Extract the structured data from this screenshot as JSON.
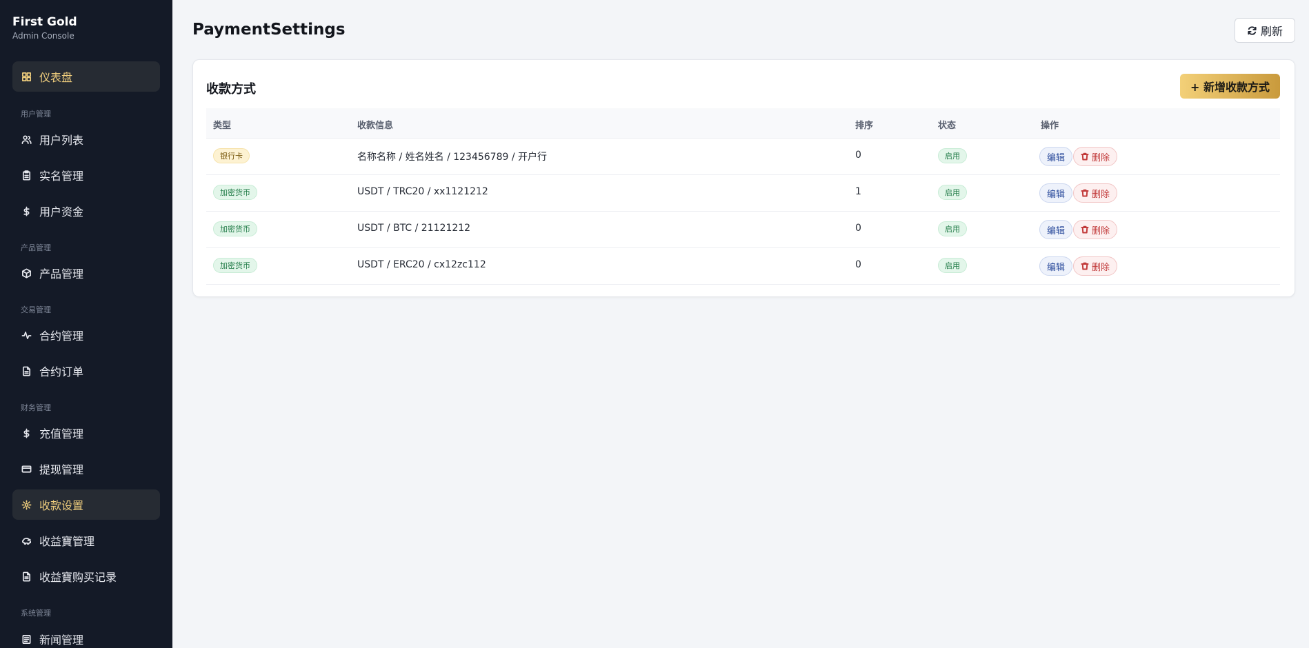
{
  "brand": {
    "title": "First Gold",
    "subtitle": "Admin Console"
  },
  "sidebar": {
    "groups": {
      "users": "用户管理",
      "products": "产品管理",
      "trading": "交易管理",
      "finance": "财务管理",
      "system": "系统管理"
    },
    "items": [
      {
        "label": "仪表盘",
        "icon": "dashboard-icon"
      },
      {
        "label": "用户列表",
        "icon": "users-icon"
      },
      {
        "label": "实名管理",
        "icon": "clipboard-icon"
      },
      {
        "label": "用户资金",
        "icon": "dollar-icon"
      },
      {
        "label": "产品管理",
        "icon": "box-icon"
      },
      {
        "label": "合约管理",
        "icon": "activity-icon"
      },
      {
        "label": "合约订单",
        "icon": "file-icon"
      },
      {
        "label": "充值管理",
        "icon": "dollar-icon"
      },
      {
        "label": "提现管理",
        "icon": "credit-card-icon"
      },
      {
        "label": "收款设置",
        "icon": "gear-icon"
      },
      {
        "label": "收益寶管理",
        "icon": "piggy-bank-icon"
      },
      {
        "label": "收益寶购买记录",
        "icon": "file-icon"
      },
      {
        "label": "新闻管理",
        "icon": "newspaper-icon"
      }
    ],
    "active_index": 9
  },
  "header": {
    "title": "PaymentSettings",
    "refresh_label": "刷新"
  },
  "card": {
    "title": "收款方式",
    "add_label": "+ 新增收款方式",
    "columns": [
      "类型",
      "收款信息",
      "排序",
      "状态",
      "操作"
    ],
    "rows": [
      {
        "type": "银行卡",
        "type_kind": "bank",
        "info": "名称名称 / 姓名姓名 / 123456789 / 开户行",
        "sort": "0",
        "status": "启用"
      },
      {
        "type": "加密货币",
        "type_kind": "crypto",
        "info": "USDT / TRC20 / xx1121212",
        "sort": "1",
        "status": "启用"
      },
      {
        "type": "加密货币",
        "type_kind": "crypto",
        "info": "USDT / BTC / 21121212",
        "sort": "0",
        "status": "启用"
      },
      {
        "type": "加密货币",
        "type_kind": "crypto",
        "info": "USDT / ERC20 / cx12zc112",
        "sort": "0",
        "status": "启用"
      }
    ],
    "edit_label": "编辑",
    "delete_label": "删除"
  },
  "colors": {
    "sidebar_bg": "#141a27",
    "accent": "#f1cf7e",
    "page_bg": "#f3f5f8"
  }
}
